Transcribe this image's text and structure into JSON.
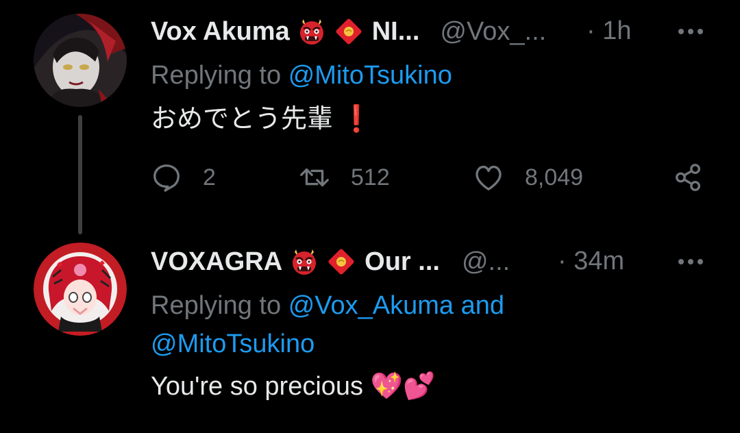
{
  "tweets": [
    {
      "author": {
        "name": "Vox Akuma",
        "name_suffix": "NI...",
        "handle": "@Vox_...",
        "time": "· 1h",
        "avatar": "vox-akuma-avatar"
      },
      "replying_label": "Replying to",
      "mentions": [
        "@MitoTsukino"
      ],
      "text": "おめでとう先輩",
      "text_emoji": "❗",
      "stats": {
        "replies": "2",
        "retweets": "512",
        "likes": "8,049"
      }
    },
    {
      "author": {
        "name": "VOXAGRA",
        "name_suffix": "Our ...",
        "handle": "@...",
        "time": "· 34m",
        "avatar": "voxagra-avatar"
      },
      "replying_label": "Replying to",
      "mentions": [
        "@Vox_Akuma",
        "@MitoTsukino"
      ],
      "conjunction": "and",
      "text": "You're so precious",
      "text_emoji": "💖💕"
    }
  ],
  "icons": {
    "name_emoji_1": "oni-icon",
    "name_emoji_2": "red-envelope-icon",
    "reply": "reply-icon",
    "retweet": "retweet-icon",
    "like": "heart-icon",
    "share": "share-icon",
    "more": "more-icon"
  },
  "colors": {
    "background": "#000000",
    "text": "#e7e9ea",
    "secondary": "#71767b",
    "link": "#1d9bf0",
    "thread_line": "#3e4144"
  }
}
